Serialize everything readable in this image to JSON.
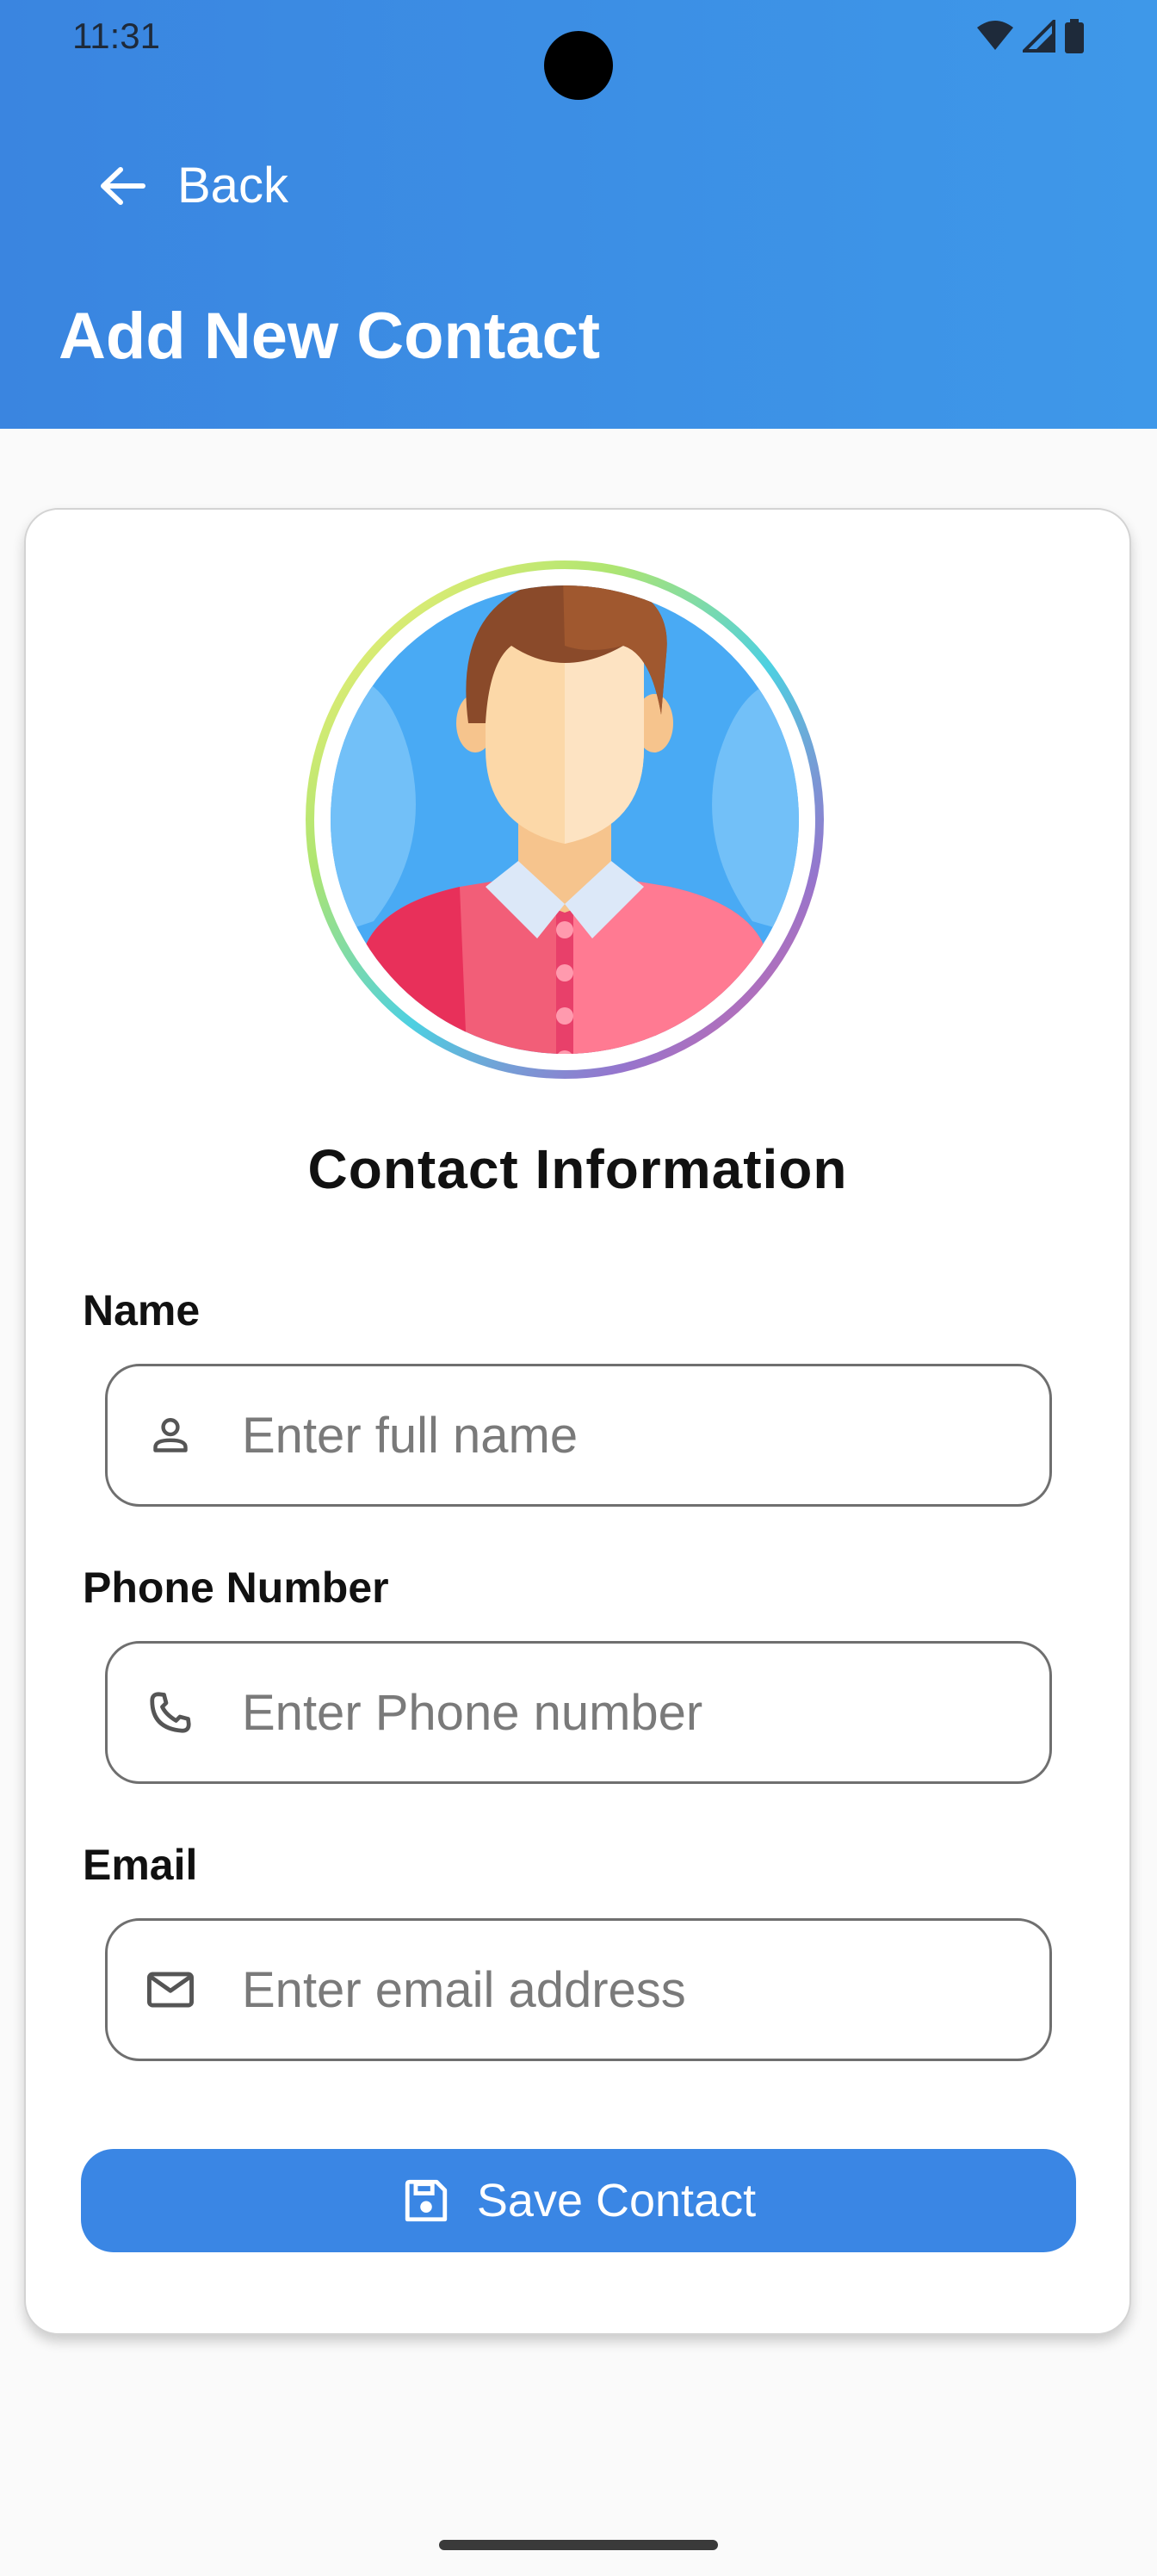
{
  "status_bar": {
    "time": "11:31"
  },
  "header": {
    "back_label": "Back",
    "title": "Add New Contact"
  },
  "card": {
    "section_title": "Contact Information",
    "fields": [
      {
        "label": "Name",
        "placeholder": "Enter full name",
        "value": "",
        "icon": "person-icon"
      },
      {
        "label": "Phone Number",
        "placeholder": "Enter Phone number",
        "value": "",
        "icon": "phone-icon"
      },
      {
        "label": "Email",
        "placeholder": "Enter email address",
        "value": "",
        "icon": "mail-icon"
      }
    ],
    "save_label": "Save Contact"
  },
  "colors": {
    "header_start": "#3a85e0",
    "header_end": "#3e98e9",
    "primary_button": "#3a86e4",
    "background": "#fafafa"
  }
}
